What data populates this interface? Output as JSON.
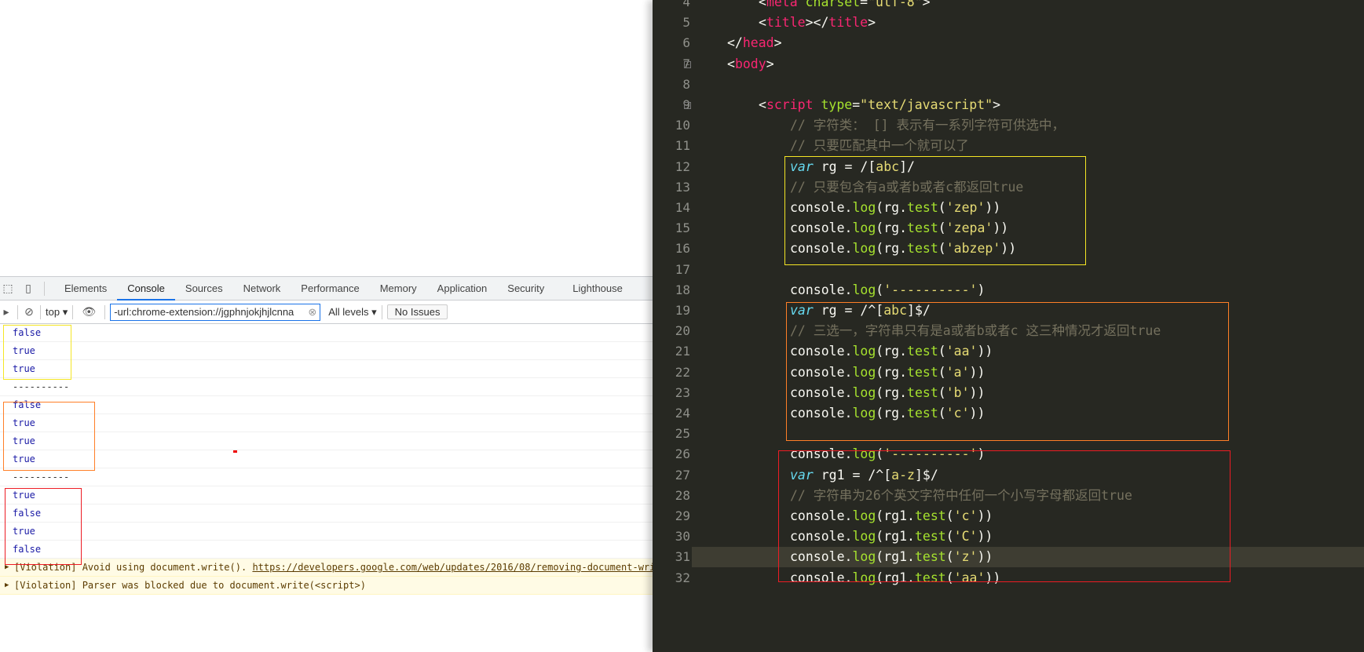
{
  "devtools": {
    "tabs": [
      "Elements",
      "Console",
      "Sources",
      "Network",
      "Performance",
      "Memory",
      "Application",
      "Security",
      "Lighthouse"
    ],
    "active_tab": "Console",
    "context": "top",
    "filter_value": "-url:chrome-extension://jgphnjokjhjlcnna",
    "levels": "All levels",
    "issues": "No Issues"
  },
  "console": {
    "rows": [
      {
        "text": "false",
        "type": "bool"
      },
      {
        "text": "true",
        "type": "bool"
      },
      {
        "text": "true",
        "type": "bool"
      },
      {
        "text": "----------",
        "type": "plain"
      },
      {
        "text": "false",
        "type": "bool"
      },
      {
        "text": "true",
        "type": "bool"
      },
      {
        "text": "true",
        "type": "bool"
      },
      {
        "text": "true",
        "type": "bool"
      },
      {
        "text": "----------",
        "type": "plain"
      },
      {
        "text": "true",
        "type": "bool"
      },
      {
        "text": "false",
        "type": "bool"
      },
      {
        "text": "true",
        "type": "bool"
      },
      {
        "text": "false",
        "type": "bool"
      }
    ],
    "violations": [
      {
        "text": "[Violation] Avoid using document.write(). ",
        "link": "https://developers.google.com/web/updates/2016/08/removing-document-write"
      },
      {
        "text": "[Violation] Parser was blocked due to document.write(<script>)",
        "link": ""
      }
    ]
  },
  "editor": {
    "colors": {
      "background": "#272822",
      "keyword": "#f92672",
      "attr": "#a6e22e",
      "string": "#e6db74",
      "storage": "#66d9ef",
      "comment": "#75715e"
    },
    "lines": [
      {
        "n": "4",
        "indent": 2,
        "parts": [
          [
            "p",
            "<"
          ],
          [
            "k",
            "meta"
          ],
          [
            "p",
            " "
          ],
          [
            "a",
            "charset"
          ],
          [
            "p",
            "="
          ],
          [
            "s",
            "\"utf-8\""
          ],
          [
            "p",
            ">"
          ]
        ]
      },
      {
        "n": "5",
        "indent": 2,
        "parts": [
          [
            "p",
            "<"
          ],
          [
            "k",
            "title"
          ],
          [
            "p",
            "></"
          ],
          [
            "k",
            "title"
          ],
          [
            "p",
            ">"
          ]
        ]
      },
      {
        "n": "6",
        "indent": 1,
        "parts": [
          [
            "p",
            "</"
          ],
          [
            "k",
            "head"
          ],
          [
            "p",
            ">"
          ]
        ]
      },
      {
        "n": "7",
        "indent": 1,
        "fold": true,
        "parts": [
          [
            "p",
            "<"
          ],
          [
            "k",
            "body"
          ],
          [
            "p",
            ">"
          ]
        ]
      },
      {
        "n": "8",
        "indent": 0,
        "parts": []
      },
      {
        "n": "9",
        "indent": 2,
        "fold": true,
        "parts": [
          [
            "p",
            "<"
          ],
          [
            "k",
            "script"
          ],
          [
            "p",
            " "
          ],
          [
            "a",
            "type"
          ],
          [
            "p",
            "="
          ],
          [
            "s",
            "\"text/javascript\""
          ],
          [
            "p",
            ">"
          ]
        ]
      },
      {
        "n": "10",
        "indent": 3,
        "parts": [
          [
            "c",
            "// 字符类： [] 表示有一系列字符可供选中，"
          ]
        ]
      },
      {
        "n": "11",
        "indent": 3,
        "parts": [
          [
            "c",
            "// 只要匹配其中一个就可以了"
          ]
        ]
      },
      {
        "n": "12",
        "indent": 3,
        "parts": [
          [
            "v",
            "var"
          ],
          [
            "p",
            " rg = /["
          ],
          [
            "s",
            "abc"
          ],
          [
            "p",
            "]/"
          ]
        ]
      },
      {
        "n": "13",
        "indent": 3,
        "parts": [
          [
            "c",
            "// 只要包含有a或者b或者c都返回true"
          ]
        ]
      },
      {
        "n": "14",
        "indent": 3,
        "parts": [
          [
            "p",
            "console."
          ],
          [
            "f",
            "log"
          ],
          [
            "p",
            "(rg."
          ],
          [
            "f",
            "test"
          ],
          [
            "p",
            "("
          ],
          [
            "s",
            "'zep'"
          ],
          [
            "p",
            "))"
          ]
        ]
      },
      {
        "n": "15",
        "indent": 3,
        "parts": [
          [
            "p",
            "console."
          ],
          [
            "f",
            "log"
          ],
          [
            "p",
            "(rg."
          ],
          [
            "f",
            "test"
          ],
          [
            "p",
            "("
          ],
          [
            "s",
            "'zepa'"
          ],
          [
            "p",
            "))"
          ]
        ]
      },
      {
        "n": "16",
        "indent": 3,
        "parts": [
          [
            "p",
            "console."
          ],
          [
            "f",
            "log"
          ],
          [
            "p",
            "(rg."
          ],
          [
            "f",
            "test"
          ],
          [
            "p",
            "("
          ],
          [
            "s",
            "'abzep'"
          ],
          [
            "p",
            "))"
          ]
        ]
      },
      {
        "n": "17",
        "indent": 0,
        "parts": []
      },
      {
        "n": "18",
        "indent": 3,
        "parts": [
          [
            "p",
            "console."
          ],
          [
            "f",
            "log"
          ],
          [
            "p",
            "("
          ],
          [
            "s",
            "'----------'"
          ],
          [
            "p",
            ")"
          ]
        ]
      },
      {
        "n": "19",
        "indent": 3,
        "parts": [
          [
            "v",
            "var"
          ],
          [
            "p",
            " rg = /^["
          ],
          [
            "s",
            "abc"
          ],
          [
            "p",
            "]$/"
          ]
        ]
      },
      {
        "n": "20",
        "indent": 3,
        "parts": [
          [
            "c",
            "// 三选一，字符串只有是a或者b或者c 这三种情况才返回true"
          ]
        ]
      },
      {
        "n": "21",
        "indent": 3,
        "parts": [
          [
            "p",
            "console."
          ],
          [
            "f",
            "log"
          ],
          [
            "p",
            "(rg."
          ],
          [
            "f",
            "test"
          ],
          [
            "p",
            "("
          ],
          [
            "s",
            "'aa'"
          ],
          [
            "p",
            "))"
          ]
        ]
      },
      {
        "n": "22",
        "indent": 3,
        "parts": [
          [
            "p",
            "console."
          ],
          [
            "f",
            "log"
          ],
          [
            "p",
            "(rg."
          ],
          [
            "f",
            "test"
          ],
          [
            "p",
            "("
          ],
          [
            "s",
            "'a'"
          ],
          [
            "p",
            "))"
          ]
        ]
      },
      {
        "n": "23",
        "indent": 3,
        "parts": [
          [
            "p",
            "console."
          ],
          [
            "f",
            "log"
          ],
          [
            "p",
            "(rg."
          ],
          [
            "f",
            "test"
          ],
          [
            "p",
            "("
          ],
          [
            "s",
            "'b'"
          ],
          [
            "p",
            "))"
          ]
        ]
      },
      {
        "n": "24",
        "indent": 3,
        "parts": [
          [
            "p",
            "console."
          ],
          [
            "f",
            "log"
          ],
          [
            "p",
            "(rg."
          ],
          [
            "f",
            "test"
          ],
          [
            "p",
            "("
          ],
          [
            "s",
            "'c'"
          ],
          [
            "p",
            "))"
          ]
        ]
      },
      {
        "n": "25",
        "indent": 0,
        "parts": []
      },
      {
        "n": "26",
        "indent": 3,
        "parts": [
          [
            "p",
            "console."
          ],
          [
            "f",
            "log"
          ],
          [
            "p",
            "("
          ],
          [
            "s",
            "'----------'"
          ],
          [
            "p",
            ")"
          ]
        ]
      },
      {
        "n": "27",
        "indent": 3,
        "parts": [
          [
            "v",
            "var"
          ],
          [
            "p",
            " rg1 = /^["
          ],
          [
            "s",
            "a-z"
          ],
          [
            "p",
            "]$/"
          ]
        ]
      },
      {
        "n": "28",
        "indent": 3,
        "parts": [
          [
            "c",
            "// 字符串为26个英文字符中任何一个小写字母都返回true"
          ]
        ]
      },
      {
        "n": "29",
        "indent": 3,
        "parts": [
          [
            "p",
            "console."
          ],
          [
            "f",
            "log"
          ],
          [
            "p",
            "(rg1."
          ],
          [
            "f",
            "test"
          ],
          [
            "p",
            "("
          ],
          [
            "s",
            "'c'"
          ],
          [
            "p",
            "))"
          ]
        ]
      },
      {
        "n": "30",
        "indent": 3,
        "parts": [
          [
            "p",
            "console."
          ],
          [
            "f",
            "log"
          ],
          [
            "p",
            "(rg1."
          ],
          [
            "f",
            "test"
          ],
          [
            "p",
            "("
          ],
          [
            "s",
            "'C'"
          ],
          [
            "p",
            "))"
          ]
        ]
      },
      {
        "n": "31",
        "indent": 3,
        "current": true,
        "parts": [
          [
            "p",
            "console."
          ],
          [
            "f",
            "log"
          ],
          [
            "p",
            "(rg1."
          ],
          [
            "f",
            "test"
          ],
          [
            "p",
            "("
          ],
          [
            "s",
            "'z'"
          ],
          [
            "p",
            "))"
          ]
        ]
      },
      {
        "n": "32",
        "indent": 3,
        "parts": [
          [
            "p",
            "console."
          ],
          [
            "f",
            "log"
          ],
          [
            "p",
            "(rg1."
          ],
          [
            "f",
            "test"
          ],
          [
            "p",
            "("
          ],
          [
            "s",
            "'aa'"
          ],
          [
            "p",
            "))"
          ]
        ]
      }
    ]
  }
}
